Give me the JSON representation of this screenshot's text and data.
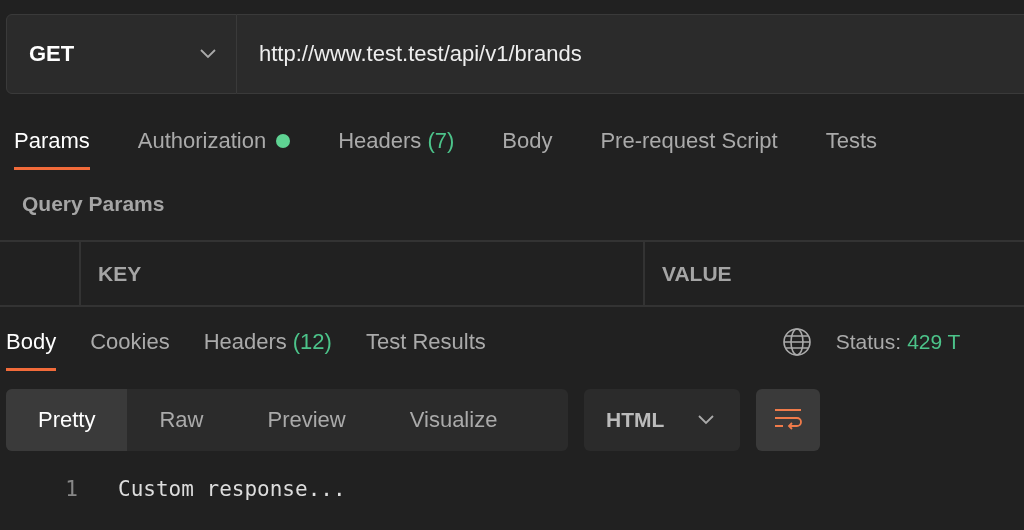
{
  "request": {
    "method": "GET",
    "url": "http://www.test.test/api/v1/brands"
  },
  "request_tabs": [
    {
      "label": "Params",
      "selected": true
    },
    {
      "label": "Authorization",
      "selected": false,
      "indicator": true
    },
    {
      "label": "Headers",
      "count": "(7)",
      "selected": false
    },
    {
      "label": "Body",
      "selected": false
    },
    {
      "label": "Pre-request Script",
      "selected": false
    },
    {
      "label": "Tests",
      "selected": false
    }
  ],
  "params": {
    "title": "Query Params",
    "columns": [
      "KEY",
      "VALUE"
    ]
  },
  "response_tabs": [
    {
      "label": "Body",
      "selected": true
    },
    {
      "label": "Cookies",
      "selected": false
    },
    {
      "label": "Headers",
      "count": "(12)",
      "selected": false
    },
    {
      "label": "Test Results",
      "selected": false
    }
  ],
  "status": {
    "label": "Status:",
    "value": "429 T"
  },
  "view_modes": [
    {
      "label": "Pretty",
      "selected": true
    },
    {
      "label": "Raw",
      "selected": false
    },
    {
      "label": "Preview",
      "selected": false
    },
    {
      "label": "Visualize",
      "selected": false
    }
  ],
  "format": "HTML",
  "code": [
    {
      "line": "1",
      "text": "Custom response..."
    }
  ]
}
